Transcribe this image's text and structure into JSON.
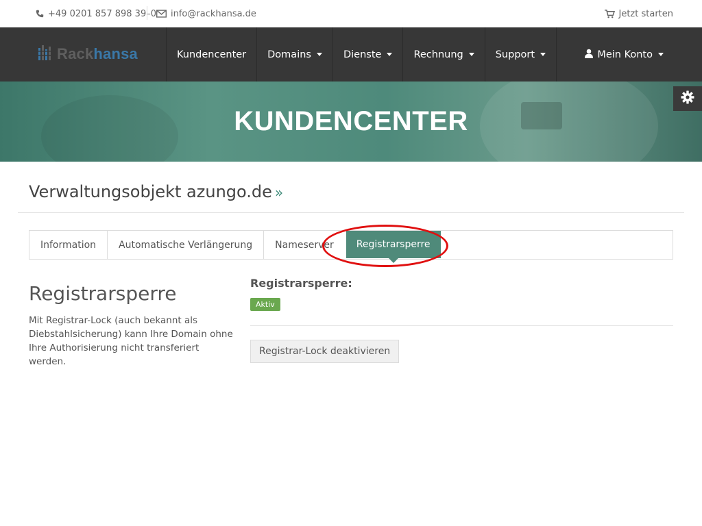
{
  "topbar": {
    "phone": "+49 0201 857 898 39–0",
    "email": "info@rackhansa.de",
    "cart_label": "Jetzt starten"
  },
  "logo": {
    "part1": "Rack",
    "part2": "hansa"
  },
  "nav": {
    "items": [
      {
        "label": "Kundencenter",
        "dropdown": false
      },
      {
        "label": "Domains",
        "dropdown": true
      },
      {
        "label": "Dienste",
        "dropdown": true
      },
      {
        "label": "Rechnung",
        "dropdown": true
      },
      {
        "label": "Support",
        "dropdown": true
      }
    ],
    "account_label": "Mein Konto"
  },
  "banner": {
    "title": "KUNDENCENTER"
  },
  "page": {
    "title": "Verwaltungsobjekt azungo.de",
    "title_suffix": "»"
  },
  "tabs": [
    {
      "label": "Information"
    },
    {
      "label": "Automatische Verlängerung"
    },
    {
      "label": "Nameserver"
    },
    {
      "label": "Registrarsperre",
      "active": true
    }
  ],
  "sidebar": {
    "heading": "Registrarsperre",
    "description": "Mit Registrar-Lock (auch bekannt als Diebstahlsicherung) kann Ihre Domain ohne Ihre Authorisierung nicht transferiert werden."
  },
  "main": {
    "status_label": "Registrarsperre:",
    "status_badge": "Aktiv",
    "action_button": "Registrar-Lock deaktivieren"
  },
  "colors": {
    "nav_bg": "#373737",
    "accent": "#4f8a7a",
    "badge_green": "#6aa84f",
    "annotation_red": "#e01010",
    "logo_blue": "#3a78a8"
  },
  "icons": {
    "phone": "phone-icon",
    "email": "envelope-icon",
    "cart": "cart-icon",
    "user": "user-icon",
    "gear": "gear-icon",
    "logo": "bars-logo-icon"
  }
}
